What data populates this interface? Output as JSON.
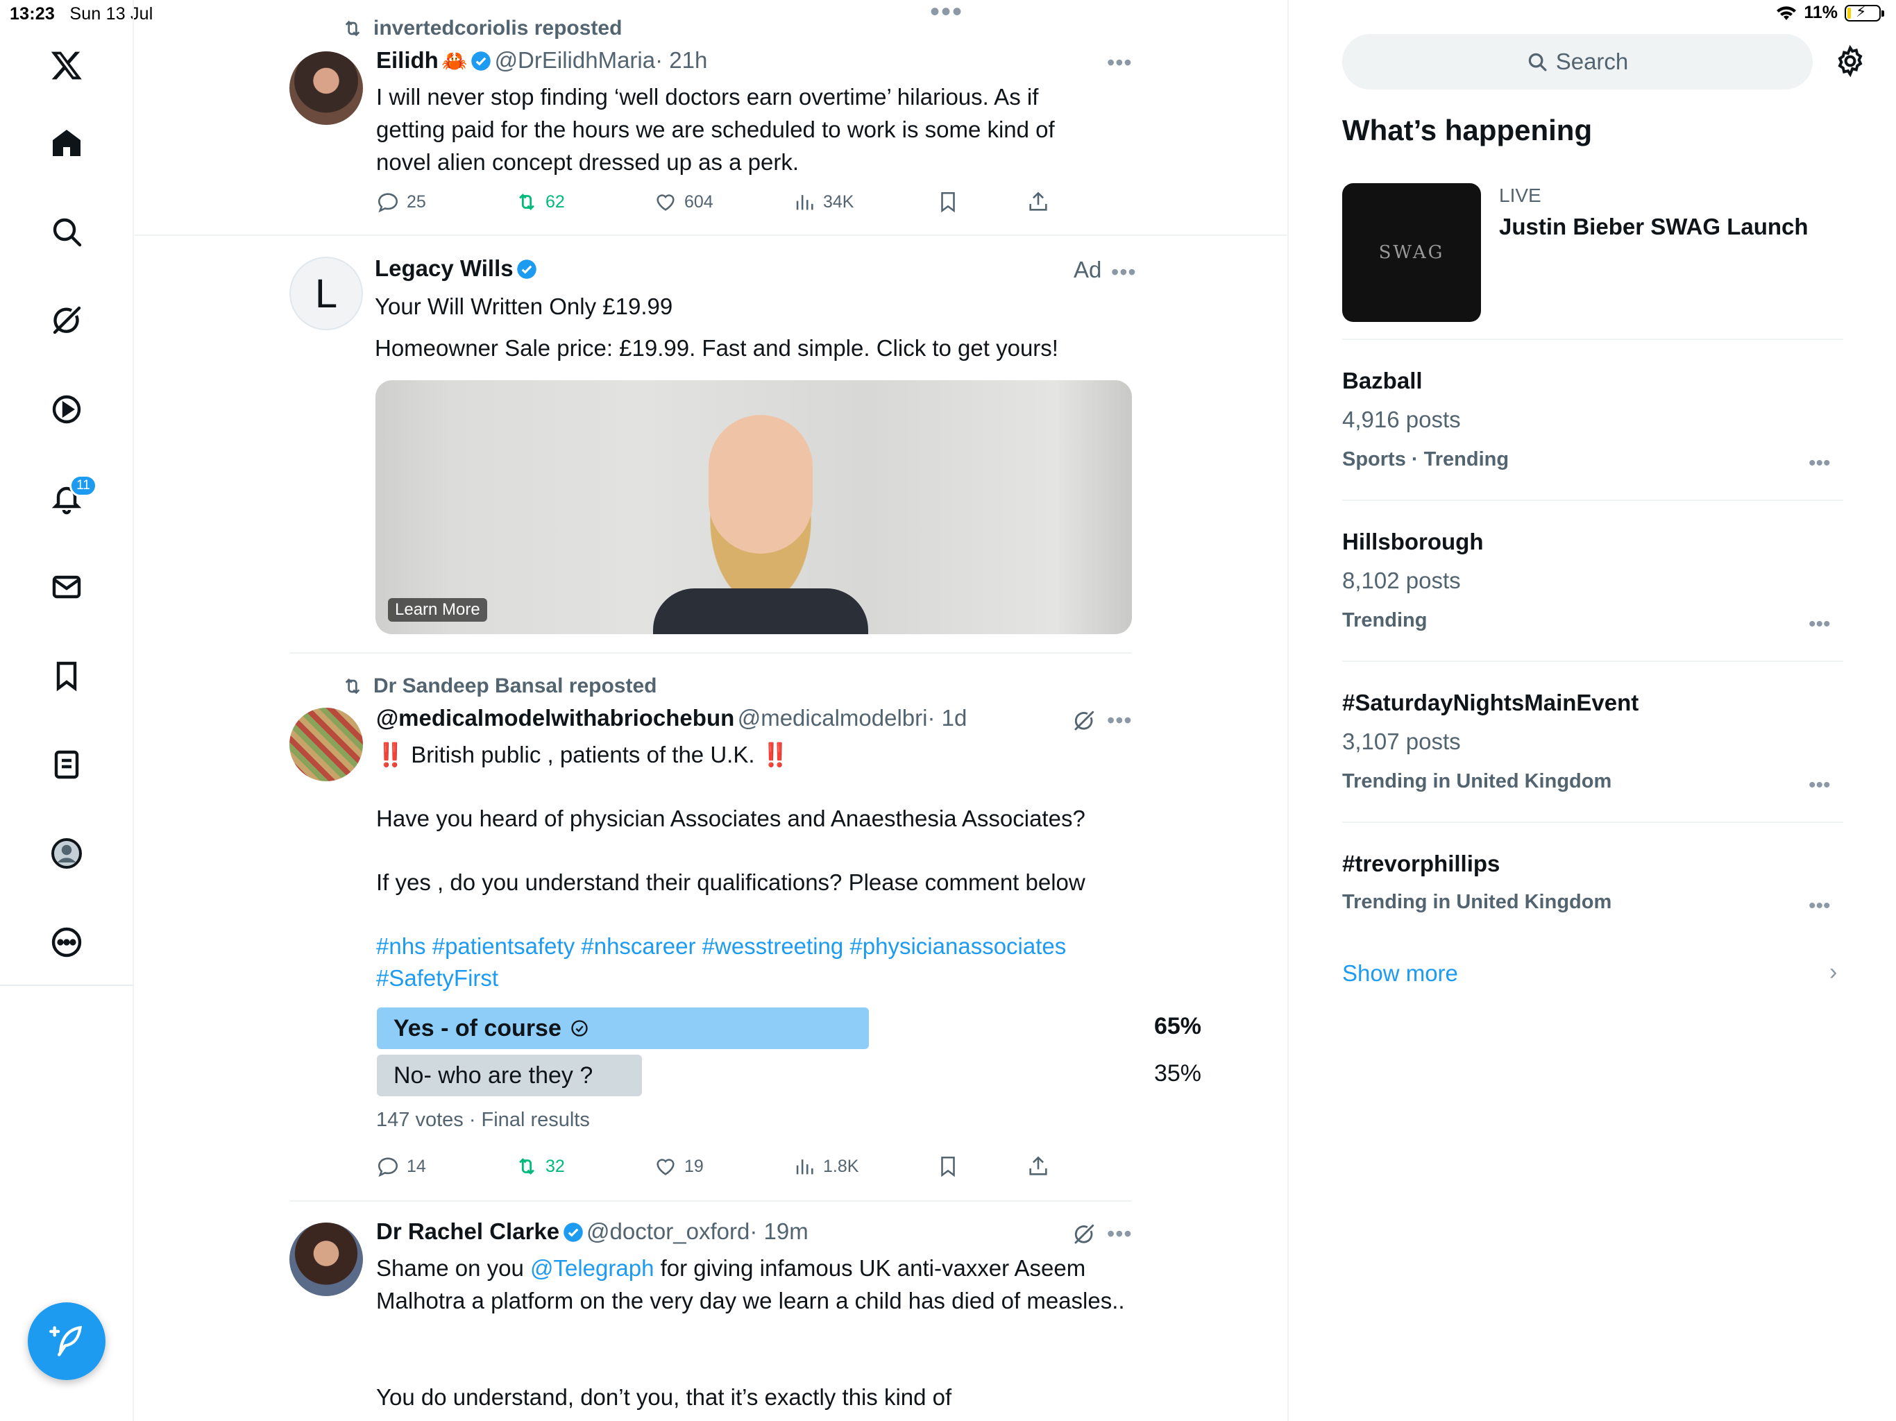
{
  "status_bar": {
    "time": "13:23",
    "date": "Sun 13 Jul",
    "battery": "11%"
  },
  "nav": {
    "notifications_badge": "11",
    "icons": [
      "x-logo-icon",
      "home-icon",
      "search-icon",
      "grok-icon",
      "video-icon",
      "bell-icon",
      "mail-icon",
      "bookmark-icon",
      "lists-icon",
      "profile-icon",
      "more-icon"
    ]
  },
  "feed": {
    "tweet1": {
      "repost_label": "invertedcoriolis reposted",
      "name": "Eilidh",
      "emoji": "🦀",
      "handle": "@DrEilidhMaria",
      "time": "· 21h",
      "text": "I will never stop finding ‘well doctors earn overtime’ hilarious. As if getting paid for the hours we are scheduled to work is some kind of novel alien concept dressed up as a perk.",
      "replies": "25",
      "reposts": "62",
      "likes": "604",
      "views": "34K"
    },
    "ad": {
      "avatar_letter": "L",
      "name": "Legacy Wills",
      "ad_label": "Ad",
      "headline": "Your Will Written Only £19.99",
      "body": "Homeowner Sale price: £19.99. Fast and simple. Click to get yours!",
      "cta": "Learn More"
    },
    "tweet2": {
      "repost_label": "Dr Sandeep Bansal reposted",
      "name": "@medicalmodelwithabriochebun",
      "handle": "@medicalmodelbri",
      "time": "· 1d",
      "line1_mark": "‼️",
      "line1": "British public , patients of the U.K.",
      "line2": "Have you heard of physician Associates and Anaesthesia Associates?",
      "line3": "If yes , do you understand their qualifications? Please comment below",
      "hashtags1": "#nhs #patientsafety #nhscareer #wesstreeting #physicianassociates",
      "hashtags2": "#SafetyFirst",
      "poll": {
        "option1": "Yes - of course",
        "option1_pct": "65%",
        "option1_value": 65,
        "option2": "No- who are they ?",
        "option2_pct": "35%",
        "option2_value": 35,
        "summary": "147 votes · Final results"
      },
      "replies": "14",
      "reposts": "32",
      "likes": "19",
      "views": "1.8K"
    },
    "tweet3": {
      "name": "Dr Rachel Clarke",
      "handle": "@doctor_oxford",
      "time": "· 19m",
      "text_pre": "Shame on you ",
      "mention": "@Telegraph",
      "text_post": " for giving infamous UK anti-vaxxer Aseem Malhotra a platform on the very day we learn a child has died of measles..",
      "text2": "You do understand, don’t you, that it’s exactly this kind of"
    }
  },
  "sidebar": {
    "search_placeholder": "Search",
    "title": "What’s happening",
    "live": {
      "label": "LIVE",
      "title": "Justin Bieber SWAG Launch",
      "thumb_text": "SWAG"
    },
    "trends": [
      {
        "name": "Bazball",
        "count": "4,916 posts",
        "context": "Sports · Trending"
      },
      {
        "name": "Hillsborough",
        "count": "8,102 posts",
        "context": "Trending"
      },
      {
        "name": "#SaturdayNightsMainEvent",
        "count": "3,107 posts",
        "context": "Trending in United Kingdom"
      },
      {
        "name": "#trevorphillips",
        "count": "",
        "context": "Trending in United Kingdom"
      }
    ],
    "show_more": "Show more"
  },
  "colors": {
    "accent": "#1d9bf0",
    "repost_green": "#00ba7c",
    "poll_winner": "#8ecdf8",
    "poll_other": "#cfd9de"
  }
}
